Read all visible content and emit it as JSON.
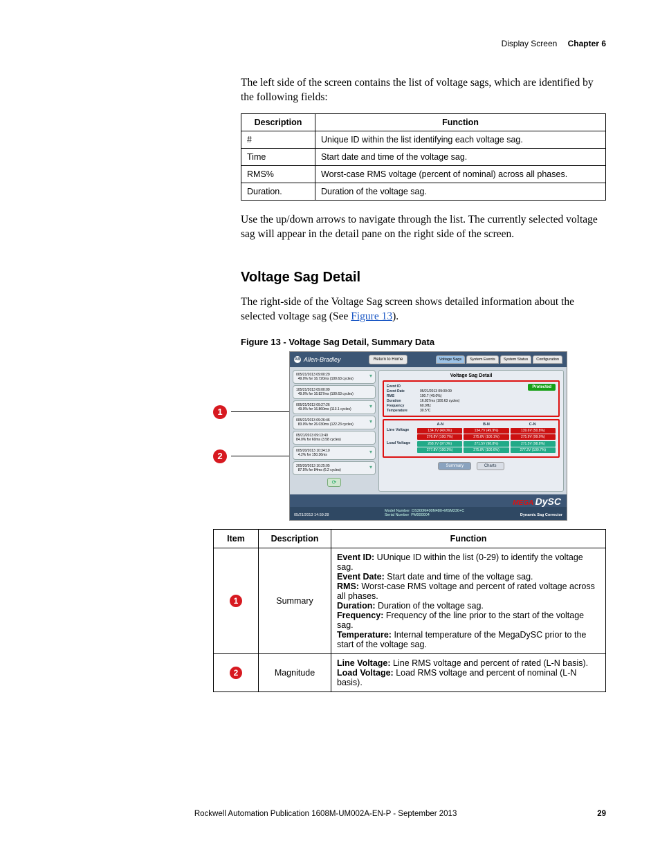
{
  "header": {
    "section": "Display Screen",
    "chapter": "Chapter 6"
  },
  "intro": "The left side of the screen contains the list of voltage sags, which are identified by the following fields:",
  "fields_table": {
    "head": {
      "desc": "Description",
      "func": "Function"
    },
    "rows": [
      {
        "desc": "#",
        "func": "Unique ID within the list identifying each voltage sag."
      },
      {
        "desc": "Time",
        "func": "Start date and time of the voltage sag."
      },
      {
        "desc": "RMS%",
        "func": "Worst-case RMS voltage (percent of nominal) across all phases."
      },
      {
        "desc": "Duration.",
        "func": "Duration of the voltage sag."
      }
    ]
  },
  "nav_text": "Use the up/down arrows to navigate through the list. The currently selected voltage sag will appear in the detail pane on the right side of the screen.",
  "subhead": "Voltage Sag Detail",
  "detail_text_a": "The right-side of the Voltage Sag screen shows detailed information about the selected voltage sag (See ",
  "detail_link": "Figure 13",
  "detail_text_b": ").",
  "fig_caption": "Figure 13 - Voltage Sag Detail, Summary Data",
  "callouts": {
    "c1": "1",
    "c2": "2"
  },
  "shot": {
    "brand": "Allen-Bradley",
    "return_home": "Return to Home",
    "tabs": {
      "vs": "Voltage Sags",
      "se": "System Events",
      "ss": "System Status",
      "cfg": "Configuration"
    },
    "list": [
      {
        "idx": "0",
        "l1": "05/21/2013 09:00:29",
        "l2": "49.0% for 16.720ms (100.63 cycles)"
      },
      {
        "idx": "1",
        "l1": "05/21/2013 09:00:09",
        "l2": "49.0% for 16.827ms (100.63 cycles)"
      },
      {
        "idx": "0",
        "l1": "05/21/2013 09:27:26",
        "l2": "49.0% for 16.860ms (113.1 cycles)"
      },
      {
        "idx": "0",
        "l1": "05/21/2013 09:26:46",
        "l2": "83.0% for 26.030ms (122.23 cycles)"
      },
      {
        "idx": "",
        "l1": "05/21/2013 09:13:40",
        "l2": "84.0% for 60ms (3.58 cycles)"
      },
      {
        "idx": "0",
        "l1": "05/20/2013 10:34:10",
        "l2": "4.2% for 150.36ms"
      },
      {
        "idx": "2",
        "l1": "05/20/2013 10:25:05",
        "l2": "87.5% for 84ms (6.2 cycles)"
      }
    ],
    "detail_title": "Voltage Sag Detail",
    "protected": "Protected",
    "fields": {
      "eid_l": "Event ID",
      "eid_v": "",
      "ed_l": "Event Date",
      "ed_v": "05/21/2013 09:00:09",
      "rms_l": "RMS",
      "rms_v": "100.7 (49.0%)",
      "dur_l": "Duration",
      "dur_v": "16.827ms (100.63 cycles)",
      "frq_l": "Frequency",
      "frq_v": "60.0Hz",
      "tmp_l": "Temperature",
      "tmp_v": "30.5°C"
    },
    "phases": {
      "a": "A-N",
      "b": "B-N",
      "c": "C-N"
    },
    "line_v": "Line Voltage",
    "load_v": "Load Voltage",
    "line_cells": {
      "a1": "134.7V (49.0%)",
      "b1": "134.7V (49.9%)",
      "c1": "139.6V (50.8%)",
      "a2": "276.8V (100.7%)",
      "b2": "275.8V (100.1%)",
      "c2": "275.9V (99.0%)"
    },
    "load_cells": {
      "a1": "268.7V (97.0%)",
      "b1": "271.5V (98.8%)",
      "c1": "271.5V (98.8%)",
      "a2": "277.8V (100.3%)",
      "b2": "275.8V (100.6%)",
      "c2": "277.2V (100.7%)"
    },
    "mini_tabs": {
      "summary": "Summary",
      "charts": "Charts"
    },
    "foot_time": "05/21/2013 14:59:28",
    "mega": "MEGA",
    "dysc": "DySC",
    "dsc_tag": "Dynamic Sag Corrector",
    "model_l": "Model Number",
    "model_v": "DS300M400N480+MSM230+C",
    "serial_l": "Serial Number",
    "serial_v": "PM000004"
  },
  "idf": {
    "head": {
      "item": "Item",
      "desc": "Description",
      "func": "Function"
    },
    "r1": {
      "num": "1",
      "desc": "Summary",
      "eid_l": "Event ID: ",
      "eid": "Unique ID within the list (0-29) to identify the voltage sag.",
      "ed_l": "Event Date: ",
      "ed": "Start date and time of the voltage sag.",
      "rms_l": "RMS: ",
      "rms": "Worst-case RMS voltage and percent of rated voltage across all phases.",
      "dur_l": "Duration: ",
      "dur": "Duration of the voltage sag.",
      "frq_l": "Frequency: ",
      "frq": "Frequency of the line prior to the start of the voltage sag.",
      "tmp_l": "Temperature: ",
      "tmp": "Internal temperature of the MegaDySC prior to the start of the voltage sag."
    },
    "r2": {
      "num": "2",
      "desc": "Magnitude",
      "lv_l": "Line Voltage: ",
      "lv": "Line RMS voltage and percent of rated (L-N basis).",
      "ld_l": "Load Voltage: ",
      "ld": "Load RMS voltage and percent of nominal (L-N basis)."
    }
  },
  "footer": {
    "pub": "Rockwell Automation Publication 1608M-UM002A-EN-P - September 2013",
    "page": "29"
  }
}
